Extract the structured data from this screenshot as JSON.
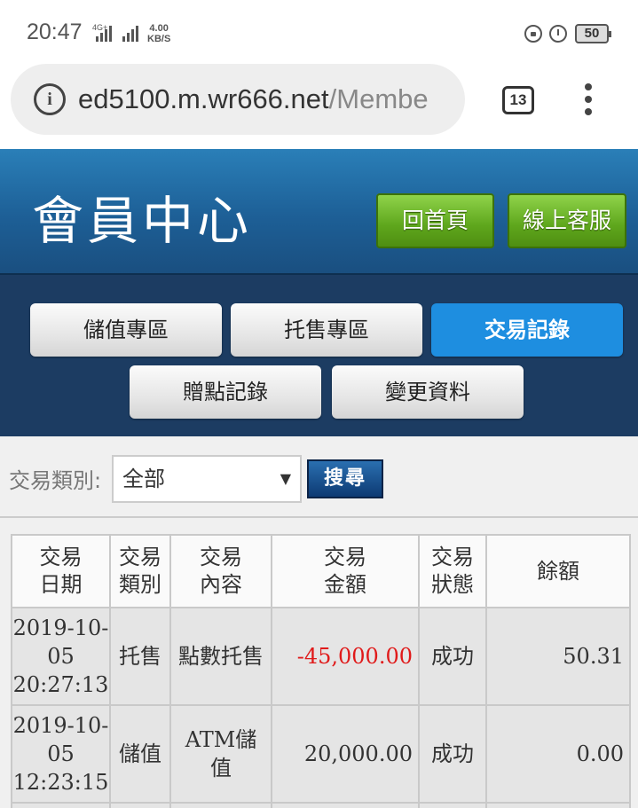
{
  "status_bar": {
    "time": "20:47",
    "network": "4G+",
    "speed_value": "4.00",
    "speed_unit": "KB/S",
    "battery": "50",
    "icons": [
      "signal-icon",
      "lock-rotation-icon",
      "alarm-icon",
      "battery-icon"
    ]
  },
  "browser": {
    "url_host": "ed5100.m.wr666.net",
    "url_path": "/Membe",
    "tab_count": "13"
  },
  "header": {
    "title": "會員中心",
    "home_button": "回首頁",
    "service_button": "線上客服",
    "accent_color": "#6db22a"
  },
  "nav": {
    "items": [
      {
        "label": "儲值專區",
        "active": false
      },
      {
        "label": "托售專區",
        "active": false
      },
      {
        "label": "交易記錄",
        "active": true
      },
      {
        "label": "贈點記錄",
        "active": false
      },
      {
        "label": "變更資料",
        "active": false
      }
    ],
    "active_color": "#1e8ee0"
  },
  "filter": {
    "label": "交易類別:",
    "selected": "全部",
    "search_button": "搜尋"
  },
  "table": {
    "headers": [
      [
        "交易",
        "日期"
      ],
      [
        "交易",
        "類別"
      ],
      [
        "交易",
        "內容"
      ],
      [
        "交易",
        "金額"
      ],
      [
        "交易",
        "狀態"
      ],
      [
        "餘額"
      ]
    ],
    "rows": [
      {
        "date": [
          "2019-10-",
          "05",
          "20:27:13"
        ],
        "type": "托售",
        "content": "點數托售",
        "amount": "-45,000.00",
        "status": "成功",
        "balance": "50.31"
      },
      {
        "date": [
          "2019-10-",
          "05",
          "12:23:15"
        ],
        "type": "儲值",
        "content": [
          "ATM儲",
          "值"
        ],
        "amount": "20,000.00",
        "status": "成功",
        "balance": "0.00"
      }
    ],
    "negative_color": "#e01a1a"
  }
}
